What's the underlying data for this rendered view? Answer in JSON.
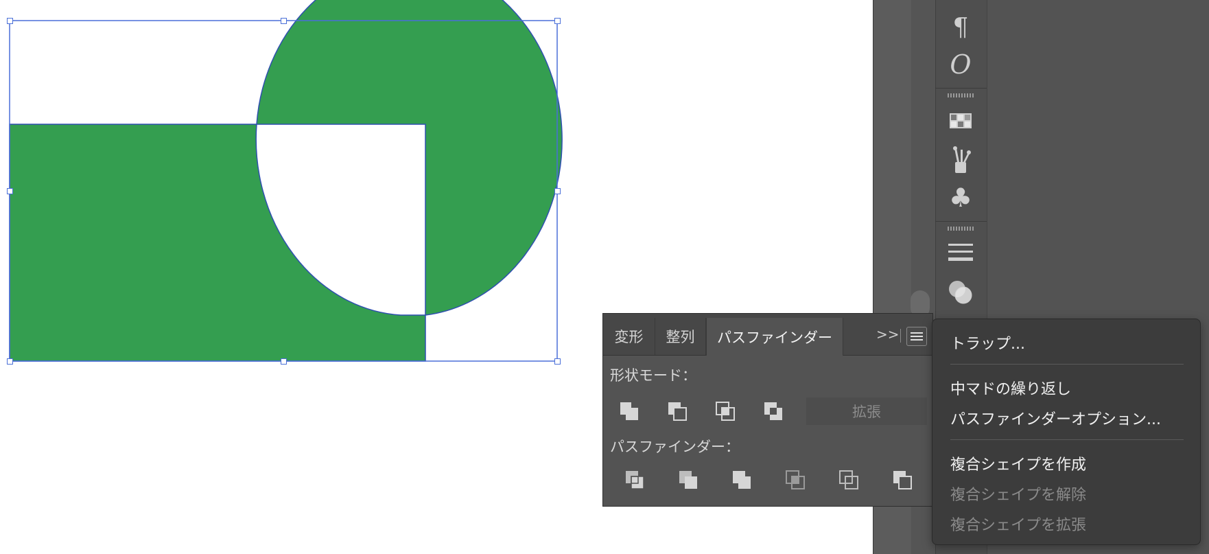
{
  "colors": {
    "shape_fill": "#349e50",
    "selection": "#4a6fd8",
    "panel_bg": "#535353",
    "menu_bg": "#3c3c3c"
  },
  "dock_icons": [
    "pilcrow-icon",
    "glyph-o-icon",
    "swatches-icon",
    "brushes-icon",
    "symbols-icon",
    "stroke-icon",
    "transparency-icon"
  ],
  "dock_icon_glyphs": {
    "pilcrow": "¶",
    "glyph_o": "O",
    "symbol": "♣"
  },
  "pathfinder_panel": {
    "tabs": [
      "変形",
      "整列",
      "パスファインダー"
    ],
    "overflow": ">>",
    "shape_modes_label": "形状モード：",
    "shape_mode_buttons": [
      "unite-icon",
      "minus-front-icon",
      "intersect-icon",
      "exclude-icon"
    ],
    "expand_label": "拡張",
    "pathfinders_label": "パスファインダー：",
    "pathfinder_buttons": [
      "divide-icon",
      "trim-icon",
      "merge-icon",
      "crop-icon",
      "outline-icon",
      "minus-back-icon"
    ]
  },
  "context_menu": {
    "items": [
      {
        "label": "トラップ...",
        "enabled": true
      },
      {
        "label": "中マドの繰り返し",
        "enabled": true
      },
      {
        "label": "パスファインダーオプション...",
        "enabled": true
      },
      {
        "label": "複合シェイプを作成",
        "enabled": true
      },
      {
        "label": "複合シェイプを解除",
        "enabled": false
      },
      {
        "label": "複合シェイプを拡張",
        "enabled": false
      }
    ]
  }
}
